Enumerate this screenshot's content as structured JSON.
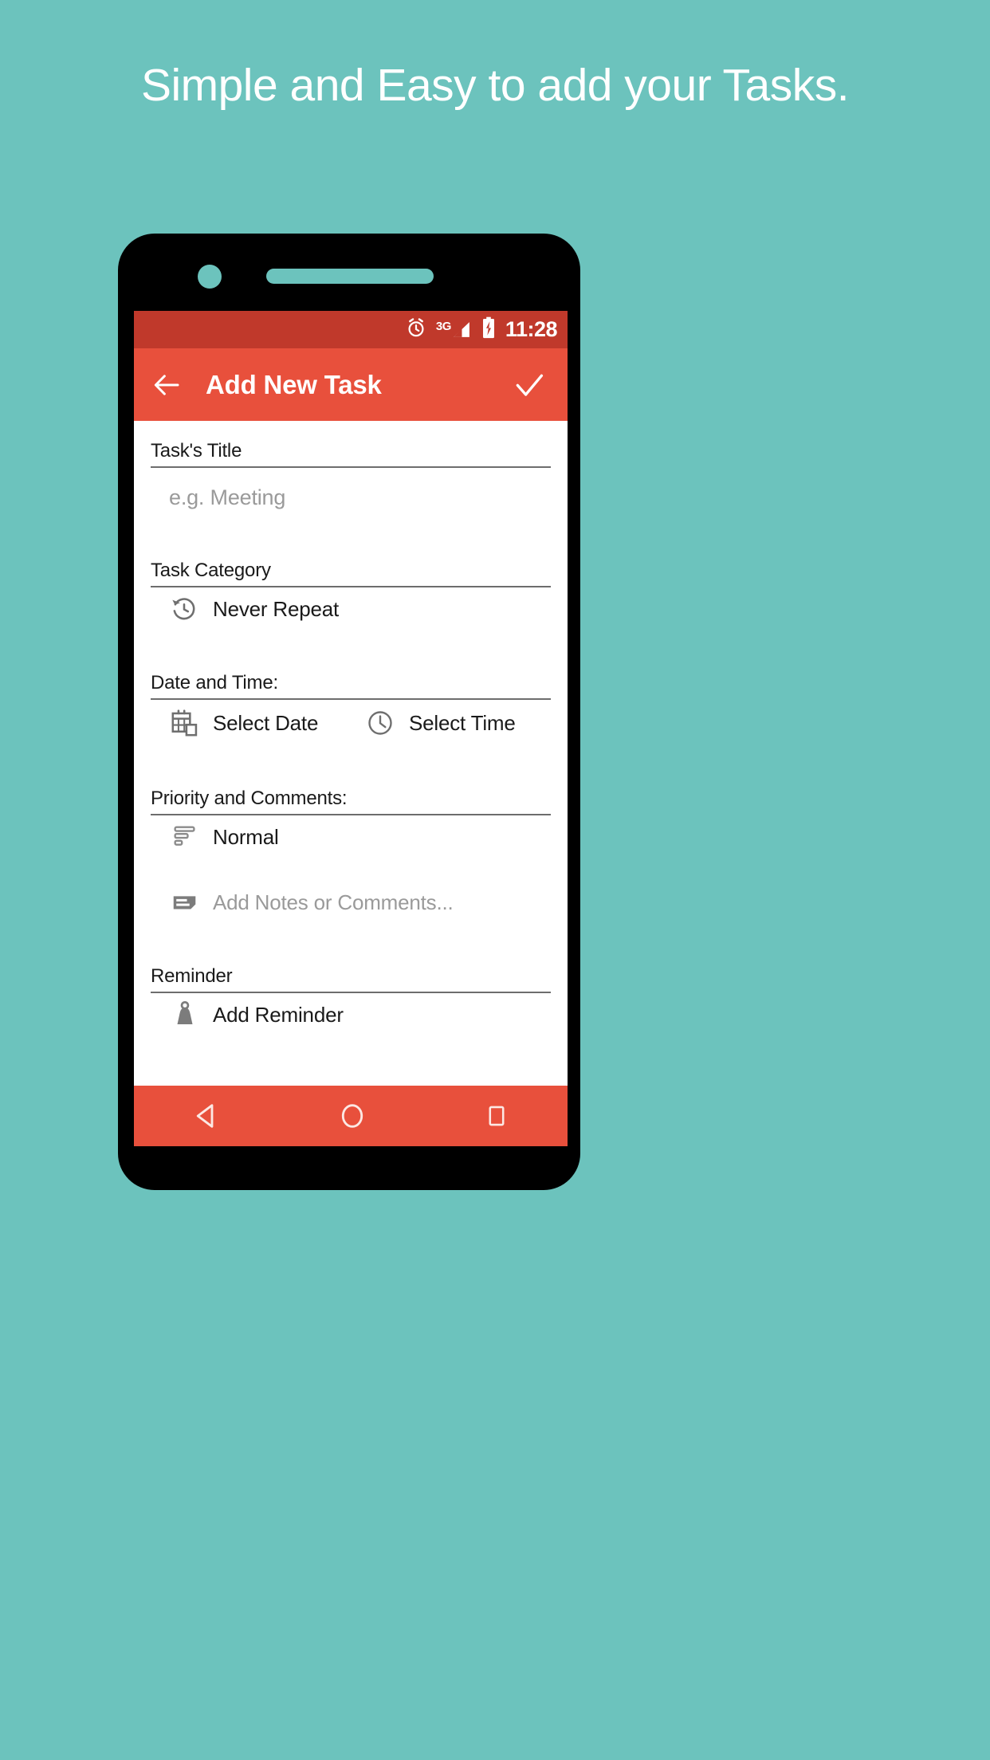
{
  "promo": {
    "headline": "Simple and Easy to add your Tasks."
  },
  "colors": {
    "background_teal": "#6cc3bd",
    "app_bar_red": "#e8503c",
    "status_bar_red": "#c0392b",
    "frame_black": "#000000",
    "screen_white": "#ffffff",
    "muted_text": "#9a9a9a"
  },
  "phone": {
    "camera_icon": "camera-dot",
    "speaker_icon": "speaker-grille"
  },
  "status_bar": {
    "alarm_icon": "alarm-icon",
    "network_label": "3G",
    "signal_icon": "signal-bars-icon",
    "battery_icon": "battery-charging-icon",
    "time": "11:28"
  },
  "app_bar": {
    "back_icon": "back-arrow-icon",
    "title": "Add New Task",
    "confirm_icon": "check-icon"
  },
  "form": {
    "title_section": {
      "label": "Task's Title",
      "input_placeholder": "e.g. Meeting",
      "input_value": ""
    },
    "category_section": {
      "label": "Task Category",
      "repeat_icon": "history-repeat-icon",
      "repeat_value": "Never Repeat"
    },
    "datetime_section": {
      "label": "Date and Time:",
      "date_icon": "calendar-icon",
      "date_value": "Select Date",
      "time_icon": "clock-icon",
      "time_value": "Select Time"
    },
    "priority_section": {
      "label": "Priority and Comments:",
      "priority_icon": "sort-lines-icon",
      "priority_value": "Normal",
      "notes_icon": "note-icon",
      "notes_placeholder": "Add Notes or Comments..."
    },
    "reminder_section": {
      "label": "Reminder",
      "reminder_icon": "bell-icon",
      "reminder_value": "Add Reminder"
    }
  },
  "nav_bar": {
    "back_icon": "nav-back-triangle-icon",
    "home_icon": "nav-home-circle-icon",
    "recents_icon": "nav-recents-square-icon"
  }
}
